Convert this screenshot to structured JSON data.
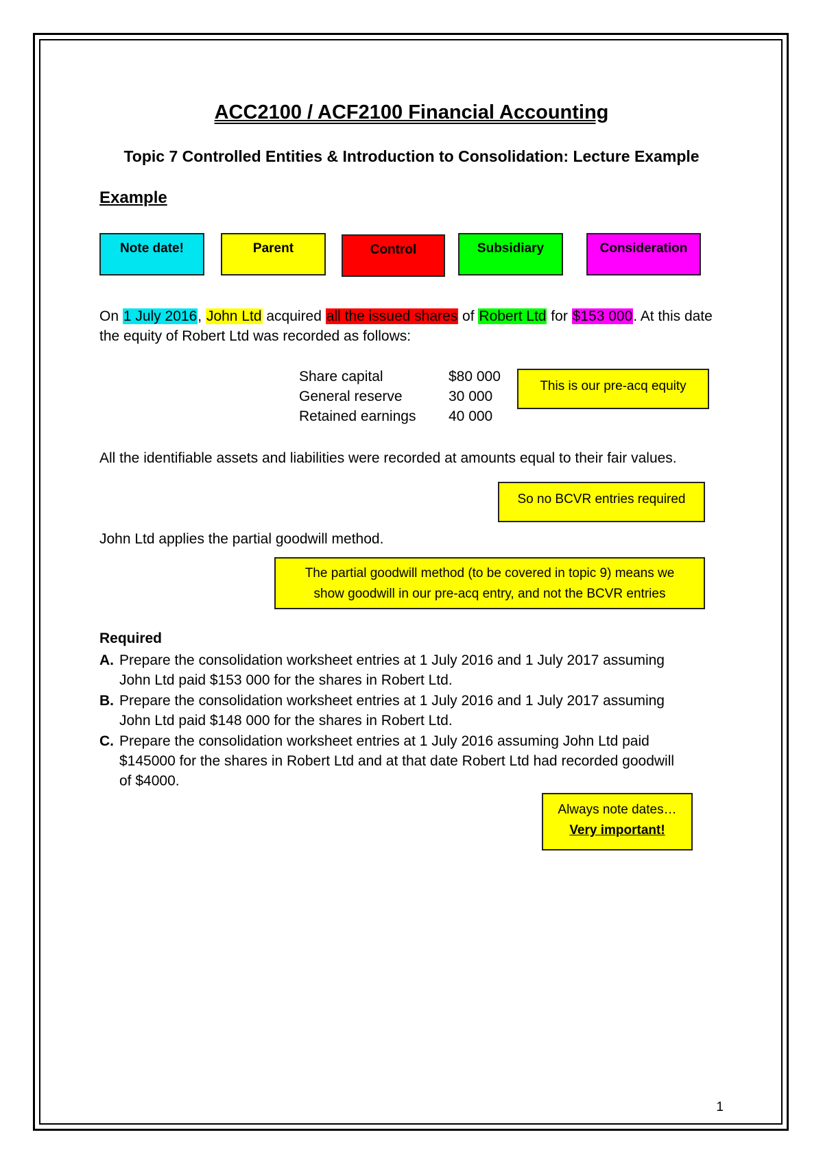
{
  "header": {
    "title": "ACC2100 / ACF2100 Financial Accounting",
    "subtitle": "Topic 7 Controlled Entities & Introduction to Consolidation: Lecture Example",
    "section": "Example"
  },
  "legend_tags": [
    {
      "label": "Note date!",
      "color": "#00e5f0"
    },
    {
      "label": "Parent",
      "color": "#ffff00"
    },
    {
      "label": "Control",
      "color": "#ff0000"
    },
    {
      "label": "Subsidiary",
      "color": "#00ff00"
    },
    {
      "label": "Consideration",
      "color": "#ff00ff"
    }
  ],
  "paragraph1": {
    "p1": "On ",
    "date": "1 July 2016",
    "p2": ", ",
    "parent": "John Ltd",
    "p3": " acquired ",
    "control": "all the issued shares",
    "p4": " of ",
    "subsidiary": "Robert Ltd",
    "p5": " for ",
    "consideration": "$153 000",
    "p6": ". At this date",
    "line2": "the equity of Robert Ltd was recorded as follows:"
  },
  "equity": [
    {
      "item": "Share capital",
      "amount": "$80 000"
    },
    {
      "item": "General reserve",
      "amount": "30 000"
    },
    {
      "item": "Retained earnings",
      "amount": "40 000"
    }
  ],
  "notes": {
    "pre_acq": "This is our pre-acq equity",
    "bcvr": "So no BCVR entries required",
    "partial_line1": "The partial goodwill method (to be covered in topic 9) means we",
    "partial_line2": "show goodwill in our pre-acq entry, and not the BCVR entries",
    "dates_line1": "Always note dates…",
    "dates_line2": "Very important!"
  },
  "paragraph2": "All the identifiable assets and liabilities were recorded at amounts equal to their fair values.",
  "paragraph3": "John Ltd applies the partial goodwill method.",
  "required": {
    "title": "Required",
    "items": [
      {
        "letter": "A.",
        "line1": "Prepare the consolidation worksheet entries at 1 July 2016 and 1 July 2017 assuming",
        "line2": "John Ltd paid $153 000 for the shares in Robert Ltd."
      },
      {
        "letter": "B.",
        "line1": "Prepare the consolidation worksheet entries at 1 July 2016 and 1 July 2017 assuming",
        "line2": "John Ltd paid $148 000 for the shares in Robert Ltd."
      },
      {
        "letter": "C.",
        "line1": "Prepare the consolidation worksheet entries at 1 July 2016 assuming John Ltd paid",
        "line2": "$145000 for the shares in Robert Ltd and at that date Robert Ltd had recorded goodwill",
        "line3": "of $4000."
      }
    ]
  },
  "page_number": "1"
}
